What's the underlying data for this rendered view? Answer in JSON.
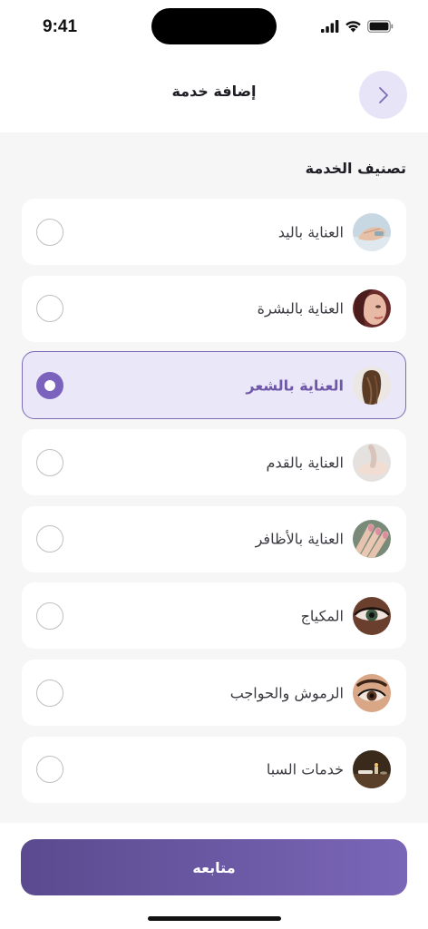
{
  "status_bar": {
    "time": "9:41"
  },
  "header": {
    "title": "إضافة خدمة",
    "back_icon": "chevron-right-icon"
  },
  "section": {
    "title": "تصنيف الخدمة"
  },
  "categories": [
    {
      "label": "العناية باليد",
      "icon": "hand-care-photo",
      "selected": false
    },
    {
      "label": "العناية بالبشرة",
      "icon": "skin-care-photo",
      "selected": false
    },
    {
      "label": "العناية بالشعر",
      "icon": "hair-care-photo",
      "selected": true
    },
    {
      "label": "العناية بالقدم",
      "icon": "foot-care-photo",
      "selected": false
    },
    {
      "label": "العناية بالأظافر",
      "icon": "nail-care-photo",
      "selected": false
    },
    {
      "label": "المكياج",
      "icon": "makeup-photo",
      "selected": false
    },
    {
      "label": "الرموش والحواجب",
      "icon": "lashes-brows-photo",
      "selected": false
    },
    {
      "label": "خدمات السبا",
      "icon": "spa-photo",
      "selected": false
    }
  ],
  "footer": {
    "continue_label": "متابعه"
  },
  "colors": {
    "accent": "#7a62bd",
    "selected_background": "#e9e7f8",
    "button_gradient_start": "#5b4a8f",
    "button_gradient_end": "#7a66b7",
    "page_background": "#f6f6f7"
  }
}
